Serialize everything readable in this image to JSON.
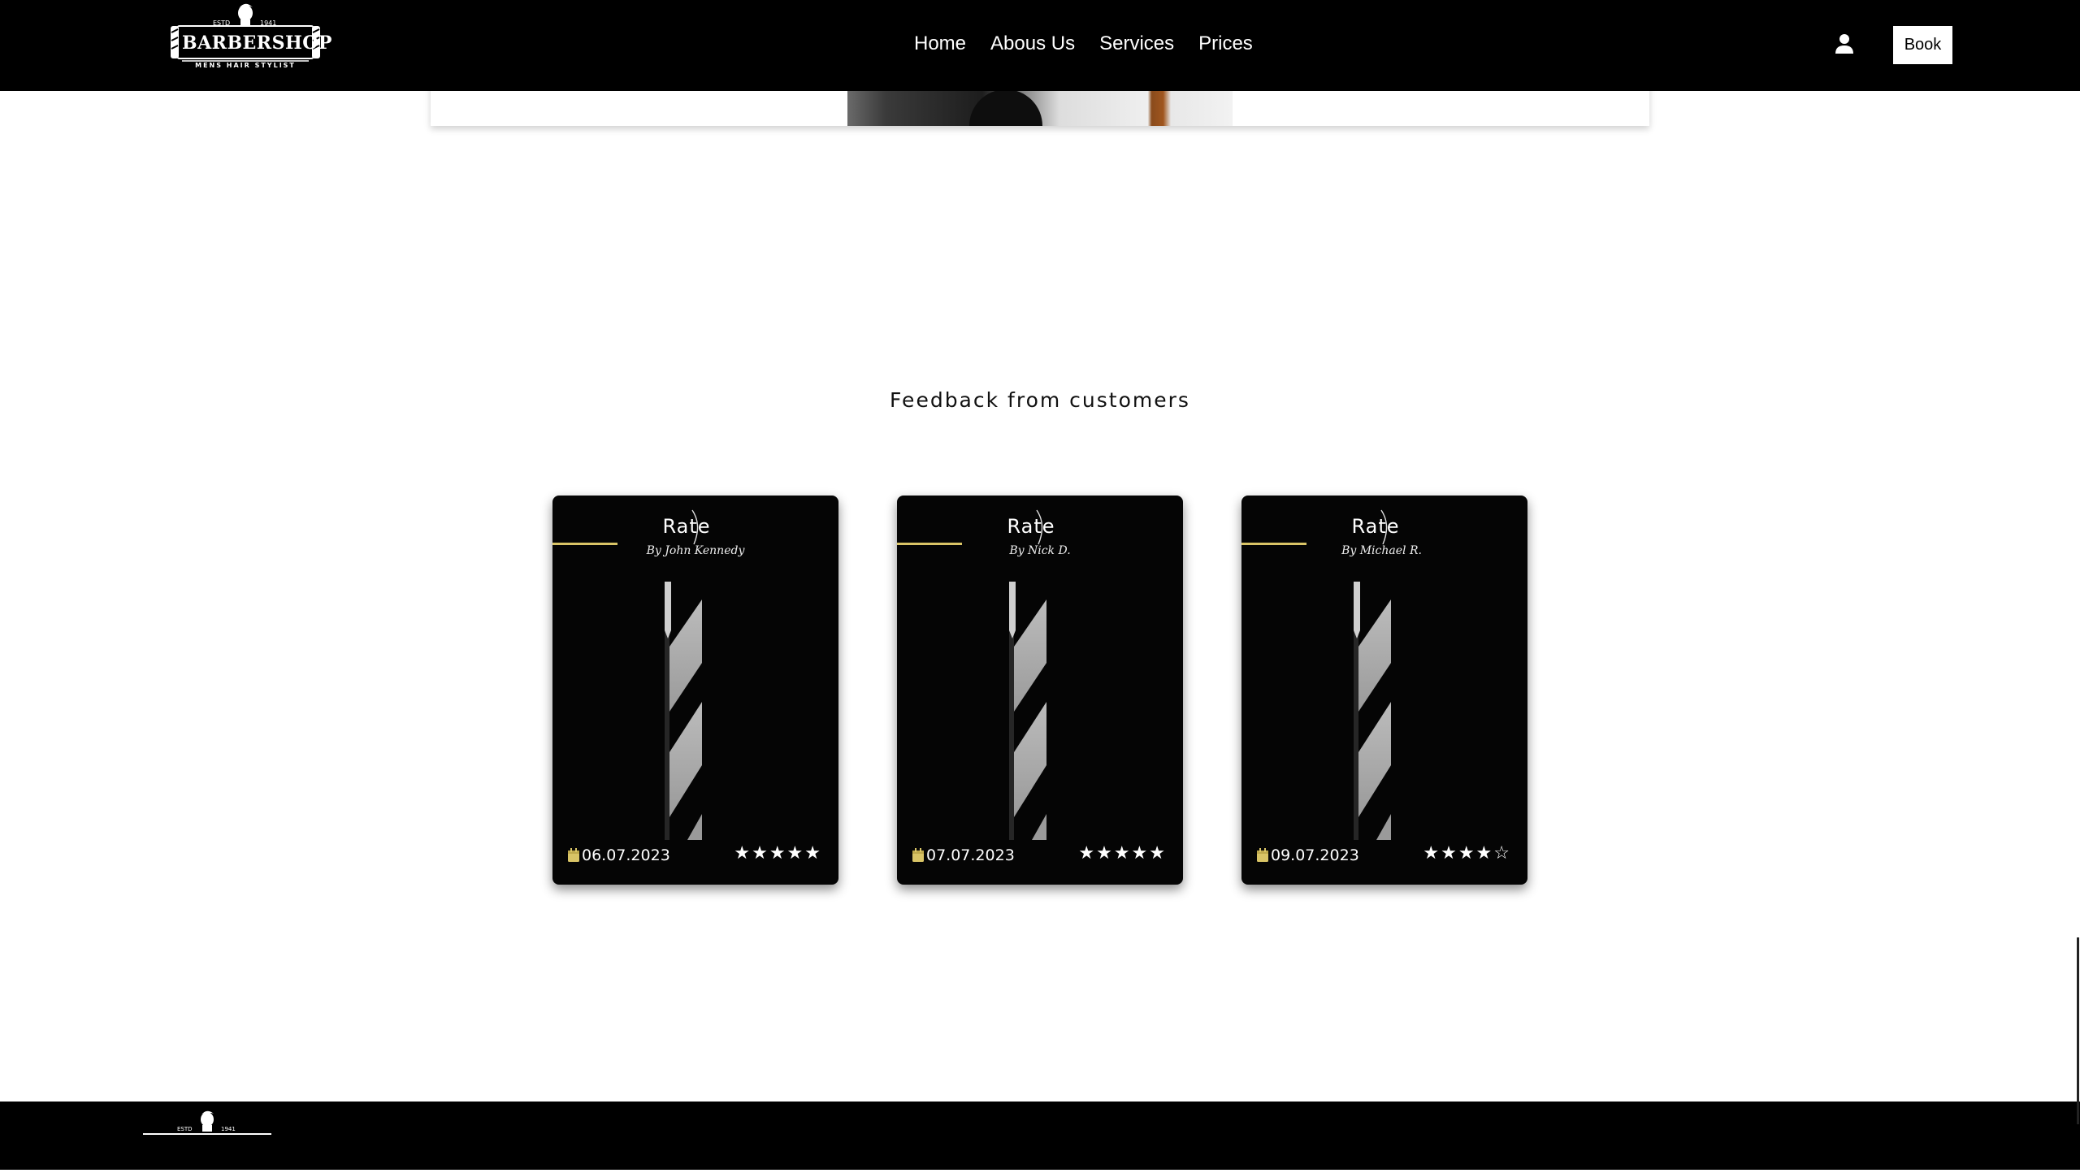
{
  "header": {
    "logo": {
      "brand": "BARBERSHOP",
      "estd": "ESTD",
      "year": "1941",
      "tagline": "MENS HAIR STYLIST"
    },
    "nav": [
      "Home",
      "Abous Us",
      "Services",
      "Prices"
    ],
    "user_icon": "user-icon",
    "book_label": "Book"
  },
  "feedback": {
    "title": "Feedback from customers",
    "cards": [
      {
        "heading": "Rate",
        "author": "By John Kennedy",
        "date": "06.07.2023",
        "stars": "★★★★★",
        "rating": 5
      },
      {
        "heading": "Rate",
        "author": "By Nick D.",
        "date": "07.07.2023",
        "stars": "★★★★★",
        "rating": 5
      },
      {
        "heading": "Rate",
        "author": "By Michael R.",
        "date": "09.07.2023",
        "stars": "★★★★☆",
        "rating": 4
      }
    ]
  },
  "colors": {
    "accent": "#d9c466",
    "card_bg": "#050505",
    "header_bg": "#000000"
  },
  "footer": {
    "logo": {
      "estd": "ESTD",
      "year": "1941"
    }
  }
}
